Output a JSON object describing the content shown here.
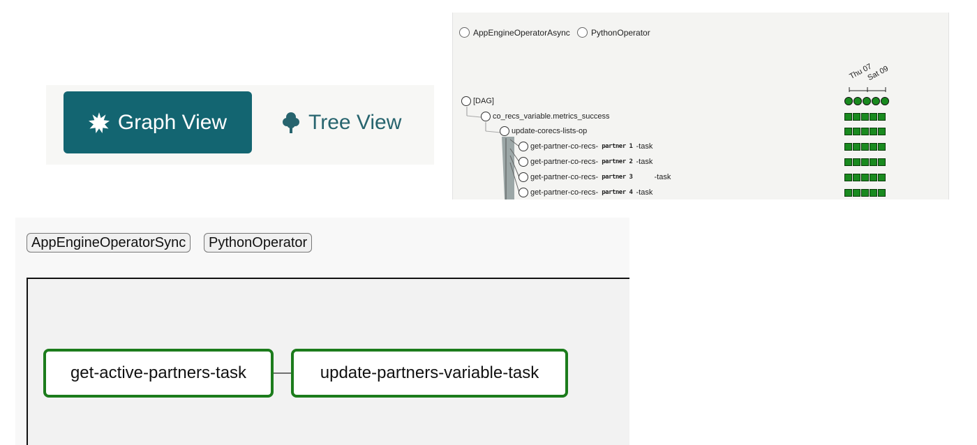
{
  "view_toggle": {
    "graph_view_label": "Graph View",
    "tree_view_label": "Tree View",
    "graph_icon": "sunburst-icon",
    "tree_icon": "tree-icon",
    "active_color": "#136571",
    "inactive_color": "#27646e"
  },
  "tree_view": {
    "operators": [
      "AppEngineOperatorAsync",
      "PythonOperator"
    ],
    "dates": [
      "Thu 07",
      "Sat 09"
    ],
    "rows": [
      {
        "label": "[DAG]",
        "type": "dag"
      },
      {
        "label": "co_recs_variable.metrics_success",
        "type": "task"
      },
      {
        "label": "update-corecs-lists-op",
        "type": "task"
      },
      {
        "label_prefix": "get-partner-co-recs-",
        "partner": "partner 1",
        "label_suffix": "-task",
        "type": "task"
      },
      {
        "label_prefix": "get-partner-co-recs-",
        "partner": "partner 2",
        "label_suffix": "-task",
        "type": "task"
      },
      {
        "label_prefix": "get-partner-co-recs-",
        "partner": "partner 3",
        "label_suffix": "-task",
        "type": "task"
      },
      {
        "label_prefix": "get-partner-co-recs-",
        "partner": "partner 4",
        "label_suffix": "-task",
        "type": "task"
      }
    ],
    "status_color": "#198a1f",
    "runs_per_row": 5
  },
  "graph_view": {
    "operators": [
      "AppEngineOperatorSync",
      "PythonOperator"
    ],
    "tasks": [
      "get-active-partners-task",
      "update-partners-variable-task"
    ],
    "task_border_color": "#1c7c1c"
  }
}
